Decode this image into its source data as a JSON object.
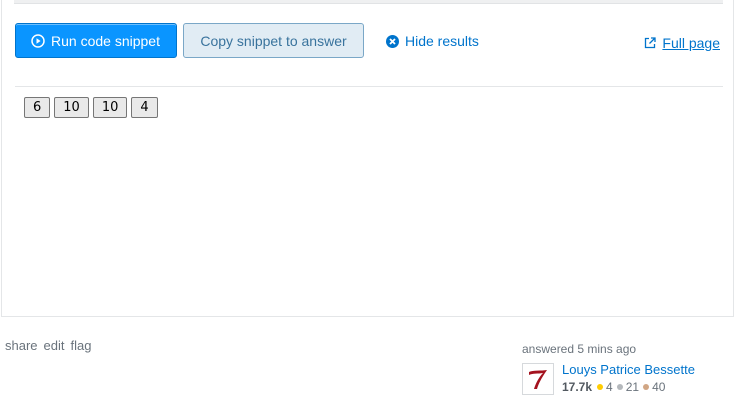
{
  "snippet": {
    "run_label": "Run code snippet",
    "copy_label": "Copy snippet to answer",
    "hide_label": "Hide results",
    "fullpage_label": "Full page"
  },
  "result": {
    "buttons": [
      "6",
      "10",
      "10",
      "4"
    ]
  },
  "post_menu": {
    "share": "share",
    "edit": "edit",
    "flag": "flag"
  },
  "signature": {
    "action": "answered 5 mins ago",
    "user_name": "Louys Patrice Bessette",
    "reputation": "17.7k",
    "gold": "4",
    "silver": "21",
    "bronze": "40",
    "colors": {
      "gold": "#ffcc01",
      "silver": "#b4b8bc",
      "bronze": "#d1a684"
    }
  },
  "theme": {
    "accent": "#0a95ff",
    "link": "#0074cc"
  }
}
